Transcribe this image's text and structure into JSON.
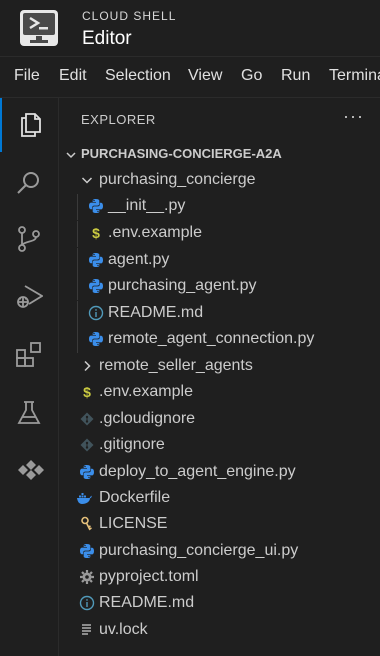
{
  "header": {
    "subtitle": "CLOUD SHELL",
    "title": "Editor"
  },
  "menu": [
    "File",
    "Edit",
    "Selection",
    "View",
    "Go",
    "Run",
    "Terminal"
  ],
  "activity_bar": [
    "explorer-icon",
    "search-icon",
    "source-control-icon",
    "run-debug-icon",
    "extensions-icon",
    "testing-icon",
    "cloud-code-icon"
  ],
  "explorer": {
    "title": "EXPLORER",
    "more": "···",
    "root": "PURCHASING-CONCIERGE-A2A",
    "items": [
      {
        "label": "purchasing_concierge",
        "icon": "chevron-down-icon",
        "type": "folder-open"
      },
      {
        "label": "__init__.py",
        "icon": "python-icon",
        "type": "file"
      },
      {
        "label": ".env.example",
        "icon": "dollar-icon",
        "type": "file"
      },
      {
        "label": "agent.py",
        "icon": "python-icon",
        "type": "file"
      },
      {
        "label": "purchasing_agent.py",
        "icon": "python-icon",
        "type": "file"
      },
      {
        "label": "README.md",
        "icon": "info-icon",
        "type": "file"
      },
      {
        "label": "remote_agent_connection.py",
        "icon": "python-icon",
        "type": "file"
      },
      {
        "label": "remote_seller_agents",
        "icon": "chevron-right-icon",
        "type": "folder-closed"
      },
      {
        "label": ".env.example",
        "icon": "dollar-icon",
        "type": "file"
      },
      {
        "label": ".gcloudignore",
        "icon": "diamond-icon",
        "type": "file"
      },
      {
        "label": ".gitignore",
        "icon": "diamond-icon",
        "type": "file"
      },
      {
        "label": "deploy_to_agent_engine.py",
        "icon": "python-icon",
        "type": "file"
      },
      {
        "label": "Dockerfile",
        "icon": "docker-icon",
        "type": "file"
      },
      {
        "label": "LICENSE",
        "icon": "key-icon",
        "type": "file"
      },
      {
        "label": "purchasing_concierge_ui.py",
        "icon": "python-icon",
        "type": "file"
      },
      {
        "label": "pyproject.toml",
        "icon": "gear-icon",
        "type": "file"
      },
      {
        "label": "README.md",
        "icon": "info-icon",
        "type": "file"
      },
      {
        "label": "uv.lock",
        "icon": "lines-icon",
        "type": "file"
      }
    ]
  },
  "colors": {
    "accent": "#0078d4",
    "python": "#3b8eea",
    "dollar": "#cbcb41",
    "diamond": "#6d8086",
    "key": "#e5c07b"
  }
}
